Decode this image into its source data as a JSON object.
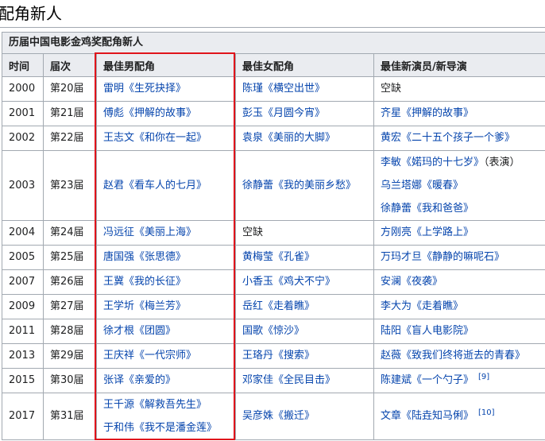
{
  "page_title": "配角新人",
  "table": {
    "caption": "历届中国电影金鸡奖配角新人",
    "headers": [
      "时间",
      "届次",
      "最佳男配角",
      "最佳女配角",
      "最佳新演员/新导演"
    ],
    "rows": [
      {
        "year": "2000",
        "edition": "第20届",
        "male": [
          [
            "雷明",
            "《生死抉择》"
          ]
        ],
        "female": [
          [
            "陈瑾",
            "《横空出世》"
          ]
        ],
        "newcomer_text": "空缺"
      },
      {
        "year": "2001",
        "edition": "第21届",
        "male": [
          [
            "傅彪",
            "《押解的故事》"
          ]
        ],
        "female": [
          [
            "彭玉",
            "《月圆今宵》"
          ]
        ],
        "newcomer": [
          [
            "齐星",
            "《押解的故事》"
          ]
        ]
      },
      {
        "year": "2002",
        "edition": "第22届",
        "male": [
          [
            "王志文",
            "《和你在一起》"
          ]
        ],
        "female": [
          [
            "袁泉",
            "《美丽的大脚》"
          ]
        ],
        "newcomer": [
          [
            "黄宏",
            "《二十五个孩子一个爹》"
          ]
        ]
      },
      {
        "year": "2003",
        "edition": "第23届",
        "male": [
          [
            "赵君",
            "《看车人的七月》"
          ]
        ],
        "female": [
          [
            "徐静蕾",
            "《我的美丽乡愁》"
          ]
        ],
        "newcomer": [
          [
            "李敏",
            "《婼玛的十七岁》",
            "（表演）"
          ],
          [
            "乌兰塔娜",
            "《暖春》"
          ],
          [
            "徐静蕾",
            "《我和爸爸》"
          ]
        ]
      },
      {
        "year": "2004",
        "edition": "第24届",
        "male": [
          [
            "冯远征",
            "《美丽上海》"
          ]
        ],
        "female_text": "空缺",
        "newcomer": [
          [
            "方刚亮",
            "《上学路上》"
          ]
        ]
      },
      {
        "year": "2005",
        "edition": "第25届",
        "male": [
          [
            "唐国强",
            "《张思德》"
          ]
        ],
        "female": [
          [
            "黄梅莹",
            "《孔雀》"
          ]
        ],
        "newcomer": [
          [
            "万玛才旦",
            "《静静的嘛呢石》"
          ]
        ]
      },
      {
        "year": "2007",
        "edition": "第26届",
        "male": [
          [
            "王冀",
            "《我的长征》"
          ]
        ],
        "female": [
          [
            "小香玉",
            "《鸡犬不宁》"
          ]
        ],
        "newcomer": [
          [
            "安澜",
            "《夜袭》"
          ]
        ]
      },
      {
        "year": "2009",
        "edition": "第27届",
        "male": [
          [
            "王学圻",
            "《梅兰芳》"
          ]
        ],
        "female": [
          [
            "岳红",
            "《走着瞧》"
          ]
        ],
        "newcomer": [
          [
            "李大为",
            "《走着瞧》"
          ]
        ]
      },
      {
        "year": "2011",
        "edition": "第28届",
        "male": [
          [
            "徐才根",
            "《团圆》"
          ]
        ],
        "female": [
          [
            "国歌",
            "《惊沙》"
          ]
        ],
        "newcomer": [
          [
            "陆阳",
            "《盲人电影院》"
          ]
        ]
      },
      {
        "year": "2013",
        "edition": "第29届",
        "male": [
          [
            "王庆祥",
            "《一代宗师》"
          ]
        ],
        "female": [
          [
            "王珞丹",
            "《搜索》"
          ]
        ],
        "newcomer": [
          [
            "赵薇",
            "《致我们终将逝去的青春》"
          ]
        ]
      },
      {
        "year": "2015",
        "edition": "第30届",
        "male": [
          [
            "张译",
            "《亲爱的》"
          ]
        ],
        "female": [
          [
            "邓家佳",
            "《全民目击》"
          ]
        ],
        "newcomer": [
          [
            "陈建斌",
            "《一个勺子》"
          ]
        ],
        "ref": "[9]"
      },
      {
        "year": "2017",
        "edition": "第31届",
        "male": [
          [
            "王千源",
            "《解救吾先生》"
          ],
          [
            "于和伟",
            "《我不是潘金莲》"
          ]
        ],
        "female": [
          [
            "吴彦姝",
            "《搬迁》"
          ]
        ],
        "newcomer": [
          [
            "文章",
            "《陆垚知马俐》"
          ]
        ],
        "ref": "[10]"
      }
    ]
  },
  "highlight_color": "#e0141b",
  "link_color": "#0645ad"
}
